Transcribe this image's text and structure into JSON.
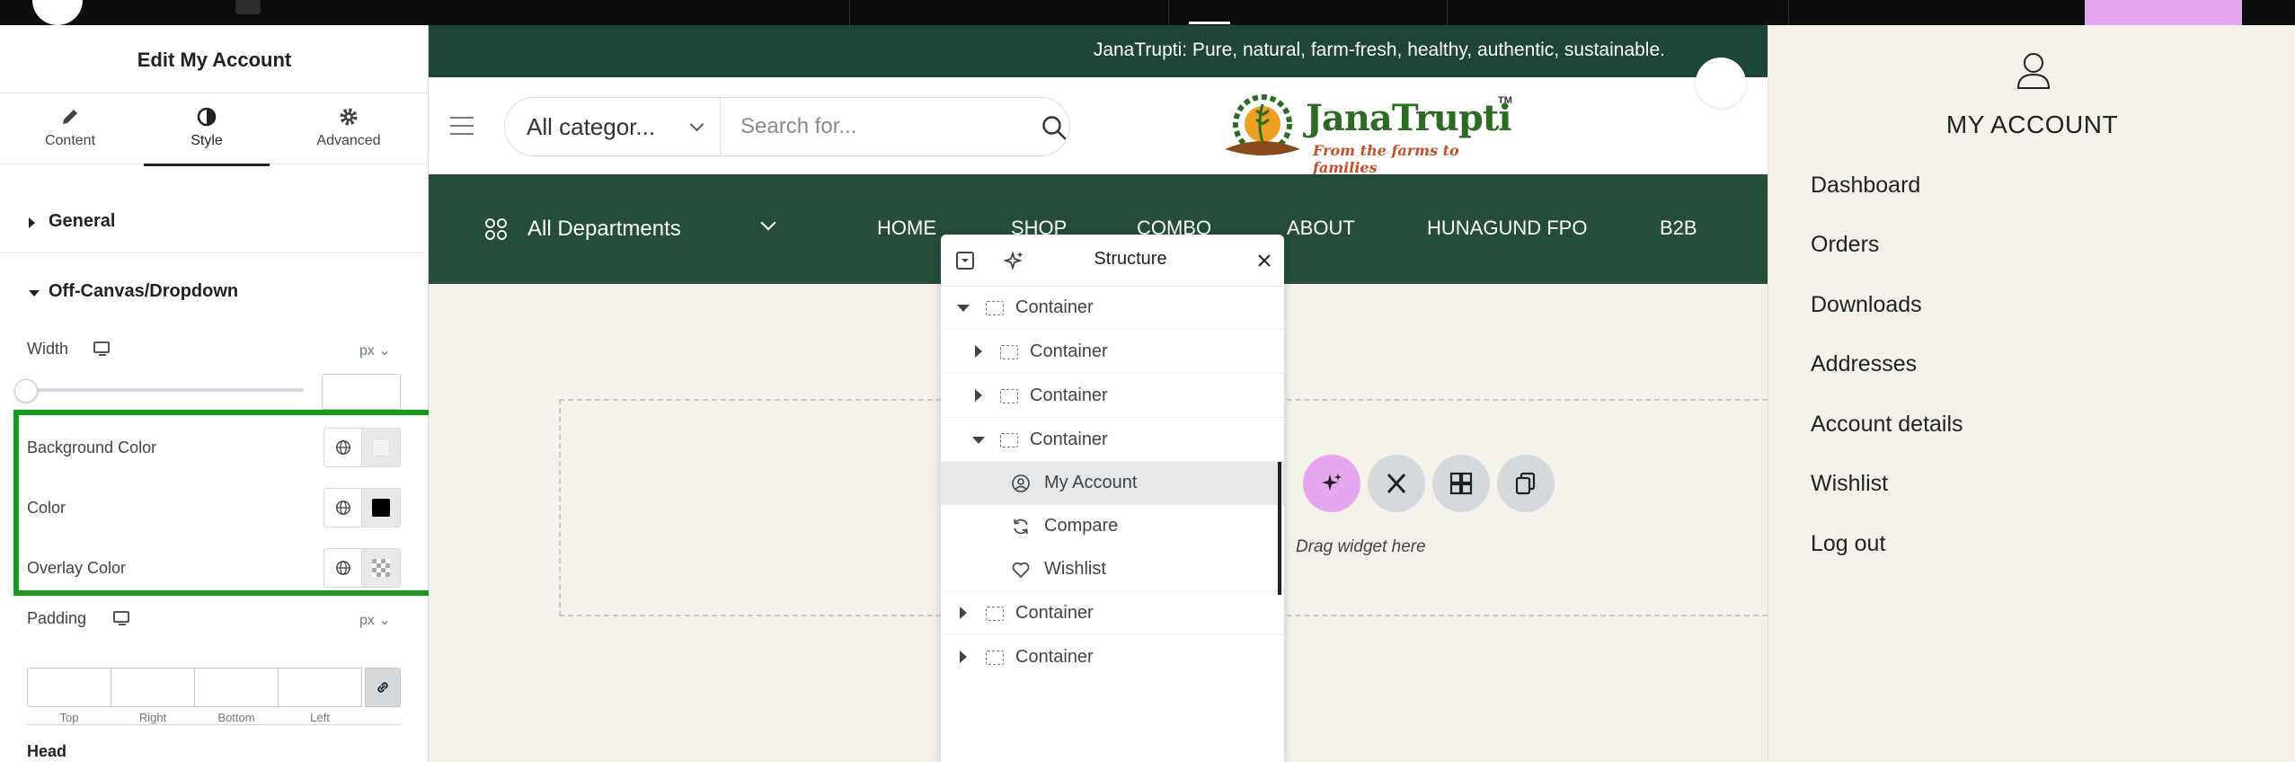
{
  "editor": {
    "title": "Edit My Account",
    "tabs": [
      {
        "label": "Content",
        "icon": "pencil-icon"
      },
      {
        "label": "Style",
        "icon": "half-circle-icon"
      },
      {
        "label": "Advanced",
        "icon": "gear-icon"
      }
    ],
    "active_tab": "Style",
    "sections": {
      "general": "General",
      "offcanvas": "Off-Canvas/Dropdown",
      "head": "Head"
    },
    "width": {
      "label": "Width",
      "unit": "px",
      "slider_value": 0
    },
    "background_color": {
      "label": "Background Color",
      "value": "#f0f0f0"
    },
    "color": {
      "label": "Color",
      "value": "#000000"
    },
    "overlay_color": {
      "label": "Overlay Color"
    },
    "padding": {
      "label": "Padding",
      "unit": "px",
      "sides": [
        "Top",
        "Right",
        "Bottom",
        "Left"
      ]
    },
    "highlight_color": "#179a1c"
  },
  "site": {
    "announcement": "JanaTrupti: Pure, natural, farm-fresh, healthy, authentic, sustainable.",
    "category_select": "All categor...",
    "search_placeholder": "Search for...",
    "brand": {
      "name": "JanaTrupti",
      "tm": "TM",
      "tagline": "From the farms to families"
    },
    "departments": "All Departments",
    "nav": [
      "HOME",
      "SHOP",
      "COMBO",
      "ABOUT",
      "HUNAGUND FPO",
      "B2B"
    ],
    "drop_text": "Drag widget here",
    "colors": {
      "announce_bg": "#1e4535",
      "nav_bg": "#264d39",
      "page_bg": "#f3f1ea"
    }
  },
  "structure": {
    "title": "Structure",
    "rows": [
      {
        "label": "Container",
        "icon": "container-icon",
        "toggle": "down"
      },
      {
        "label": "Container",
        "icon": "container-icon",
        "toggle": "right"
      },
      {
        "label": "Container",
        "icon": "container-icon",
        "toggle": "right"
      },
      {
        "label": "Container",
        "icon": "container-icon",
        "toggle": "down"
      },
      {
        "label": "My Account",
        "icon": "user-circle-icon",
        "active": true
      },
      {
        "label": "Compare",
        "icon": "refresh-icon"
      },
      {
        "label": "Wishlist",
        "icon": "heart-icon"
      },
      {
        "label": "Container",
        "icon": "container-icon",
        "toggle": "right"
      },
      {
        "label": "Container",
        "icon": "container-icon",
        "toggle": "right"
      }
    ]
  },
  "account": {
    "title": "MY ACCOUNT",
    "links": [
      "Dashboard",
      "Orders",
      "Downloads",
      "Addresses",
      "Account details",
      "Wishlist",
      "Log out"
    ]
  }
}
